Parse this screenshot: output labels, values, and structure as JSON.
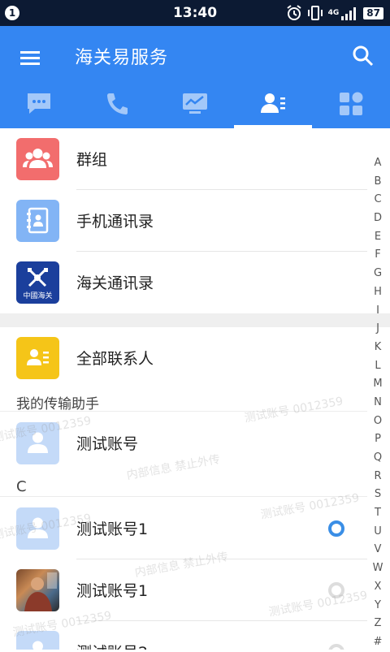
{
  "status_bar": {
    "notification_count": "1",
    "time": "13:40",
    "network": "4G",
    "battery": "87"
  },
  "app_bar": {
    "title": "海关易服务",
    "tabs": [
      {
        "icon": "chat-icon"
      },
      {
        "icon": "phone-icon"
      },
      {
        "icon": "monitor-icon"
      },
      {
        "icon": "contacts-icon",
        "selected": true
      },
      {
        "icon": "apps-icon"
      }
    ]
  },
  "contacts": {
    "top_entries": [
      {
        "label": "群组",
        "icon": "group-icon",
        "color": "#f26d6d"
      },
      {
        "label": "手机通讯录",
        "icon": "address-book-icon",
        "color": "#82b4f5"
      },
      {
        "label": "海关通讯录",
        "icon": "customs-emblem-icon",
        "color": "#1b3f9c",
        "emblem_text": "中國海关"
      }
    ],
    "all_contacts": {
      "label": "全部联系人",
      "icon": "contact-card-icon",
      "color": "#f5c518"
    },
    "transfer_helper_header": "我的传输助手",
    "transfer_helper": {
      "label": "测试账号"
    },
    "section_c": "C",
    "section_c_items": [
      {
        "label": "测试账号1",
        "status": "online"
      },
      {
        "label": "测试账号1",
        "status": "offline"
      },
      {
        "label": "测试账号2",
        "status": "offline"
      }
    ]
  },
  "watermark": {
    "account": "测试账号 0012359",
    "notice": "内部信息 禁止外传"
  },
  "index_letters": [
    "A",
    "B",
    "C",
    "D",
    "E",
    "F",
    "G",
    "H",
    "I",
    "J",
    "K",
    "L",
    "M",
    "N",
    "O",
    "P",
    "Q",
    "R",
    "S",
    "T",
    "U",
    "V",
    "W",
    "X",
    "Y",
    "Z",
    "#"
  ],
  "colors": {
    "status_bar": "#0c1a33",
    "app_bar": "#3486f2",
    "online": "#3a8ee6",
    "offline": "#dddddd"
  }
}
